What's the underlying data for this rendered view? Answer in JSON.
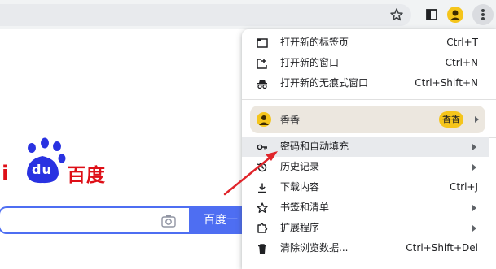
{
  "toolbar": {
    "icons": [
      "star-icon",
      "side-panel-icon",
      "profile-avatar-icon",
      "more-menu-icon"
    ]
  },
  "baidu": {
    "logo_text_left": "i",
    "logo_paw_text": "du",
    "logo_text_right": "百度",
    "search_button": "百度一下",
    "brand_red": "#de0f17",
    "brand_blue": "#4e6ef2"
  },
  "menu": {
    "new_tab": {
      "label": "打开新的标签页",
      "shortcut": "Ctrl+T"
    },
    "new_window": {
      "label": "打开新的窗口",
      "shortcut": "Ctrl+N"
    },
    "new_incognito": {
      "label": "打开新的无痕式窗口",
      "shortcut": "Ctrl+Shift+N"
    },
    "profile": {
      "name": "香香",
      "badge": "香香"
    },
    "passwords": {
      "label": "密码和自动填充"
    },
    "history": {
      "label": "历史记录"
    },
    "downloads": {
      "label": "下载内容",
      "shortcut": "Ctrl+J"
    },
    "bookmarks": {
      "label": "书签和清单"
    },
    "extensions": {
      "label": "扩展程序"
    },
    "clear_data": {
      "label": "清除浏览数据...",
      "shortcut": "Ctrl+Shift+Del"
    }
  },
  "annotation": {
    "color": "#e0242a"
  }
}
